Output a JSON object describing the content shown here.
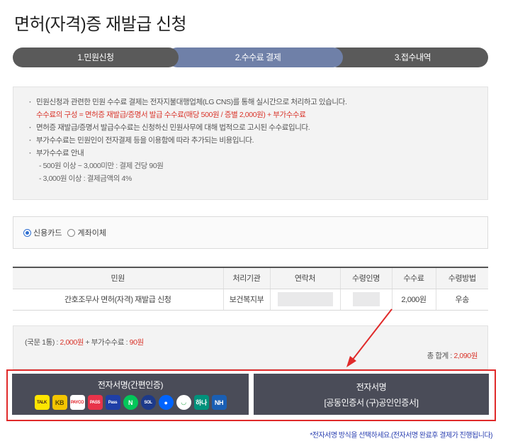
{
  "page": {
    "title": "면허(자격)증 재발급 신청"
  },
  "stepper": [
    {
      "label": "1.민원신청"
    },
    {
      "label": "2.수수료 결제"
    },
    {
      "label": "3.접수내역"
    }
  ],
  "info": {
    "line1": "민원신청과 관련한 민원 수수료 결제는 전자지불대행업체(LG CNS)를 통해 실시간으로 처리하고 있습니다.",
    "line1_red": "수수료의 구성 = 면허증 재발급/증명서 발급 수수료(매당 500원 / 증별 2,000원) + 부가수수료",
    "line2": "면허증 재발급/증명서 발급수수료는 신청하신 민원사무에 대해 법적으로 고시된 수수료입니다.",
    "line3": "부가수수료는 민원인이 전자결제 등을 이용함에 따라 추가되는 비용입니다.",
    "line4": "부가수수료 안내",
    "sub1": "- 500원 이상 ~ 3,000미만 : 결제 건당 90원",
    "sub2": "- 3,000원 이상 : 결제금액의 4%"
  },
  "payment": {
    "options": [
      {
        "label": "신용카드",
        "selected": true
      },
      {
        "label": "계좌이체",
        "selected": false
      }
    ]
  },
  "table": {
    "headers": [
      "민원",
      "처리기관",
      "연락처",
      "수령인명",
      "수수료",
      "수령방법"
    ],
    "rows": [
      {
        "civil": "간호조무사 면허(자격) 재발급 신청",
        "agency": "보건복지부",
        "fee": "2,000원",
        "delivery": "우송"
      }
    ]
  },
  "summary": {
    "prefix": "(국문 1통) : ",
    "base_fee": "2,000원",
    "plus": " + 부가수수료 : ",
    "extra_fee": "90원",
    "total_label": "총 합계 : ",
    "total_value": "2,090원"
  },
  "sign": {
    "easy_label": "전자서명(간편인증)",
    "cert_label": "전자서명",
    "cert_sub": "[공동인증서 (구)공인인증서]",
    "providers": [
      {
        "icon": "kakao-talk-icon",
        "text": "TALK",
        "bg": "#fee500",
        "fg": "#3a1d1d"
      },
      {
        "icon": "kb-icon",
        "text": "KB",
        "bg": "#f3c500",
        "fg": "#5a4a00"
      },
      {
        "icon": "payco-icon",
        "text": "PAYCO",
        "bg": "#ffffff",
        "fg": "#e0242b"
      },
      {
        "icon": "pass-icon",
        "text": "PASS",
        "bg": "#e8334a",
        "fg": "#ffffff"
      },
      {
        "icon": "samsung-pass-icon",
        "text": "Pass",
        "bg": "#1f3fa7",
        "fg": "#ffffff"
      },
      {
        "icon": "naver-icon",
        "text": "N",
        "bg": "#03c75a",
        "fg": "#ffffff"
      },
      {
        "icon": "shinhan-icon",
        "text": "SOL",
        "bg": "#1d3a8a",
        "fg": "#ffffff"
      },
      {
        "icon": "toss-icon",
        "text": "●",
        "bg": "#0064ff",
        "fg": "#ffffff"
      },
      {
        "icon": "health-insurance-icon",
        "text": "◡",
        "bg": "#ffffff",
        "fg": "#2fa84f"
      },
      {
        "icon": "hana-icon",
        "text": "하나",
        "bg": "#00927c",
        "fg": "#ffffff"
      },
      {
        "icon": "nh-icon",
        "text": "NH",
        "bg": "#1a5fb4",
        "fg": "#ffffff"
      }
    ]
  },
  "notice": "*전자서명 방식을 선택하세요.(전자서명 완료후 결제가 진행됩니다)",
  "colors": {
    "accent": "#6f80a8",
    "step": "#5a5a5a",
    "sign_button": "#4a4c58",
    "alert_red": "#e02a2a",
    "notice_blue": "#2a3fb0"
  }
}
